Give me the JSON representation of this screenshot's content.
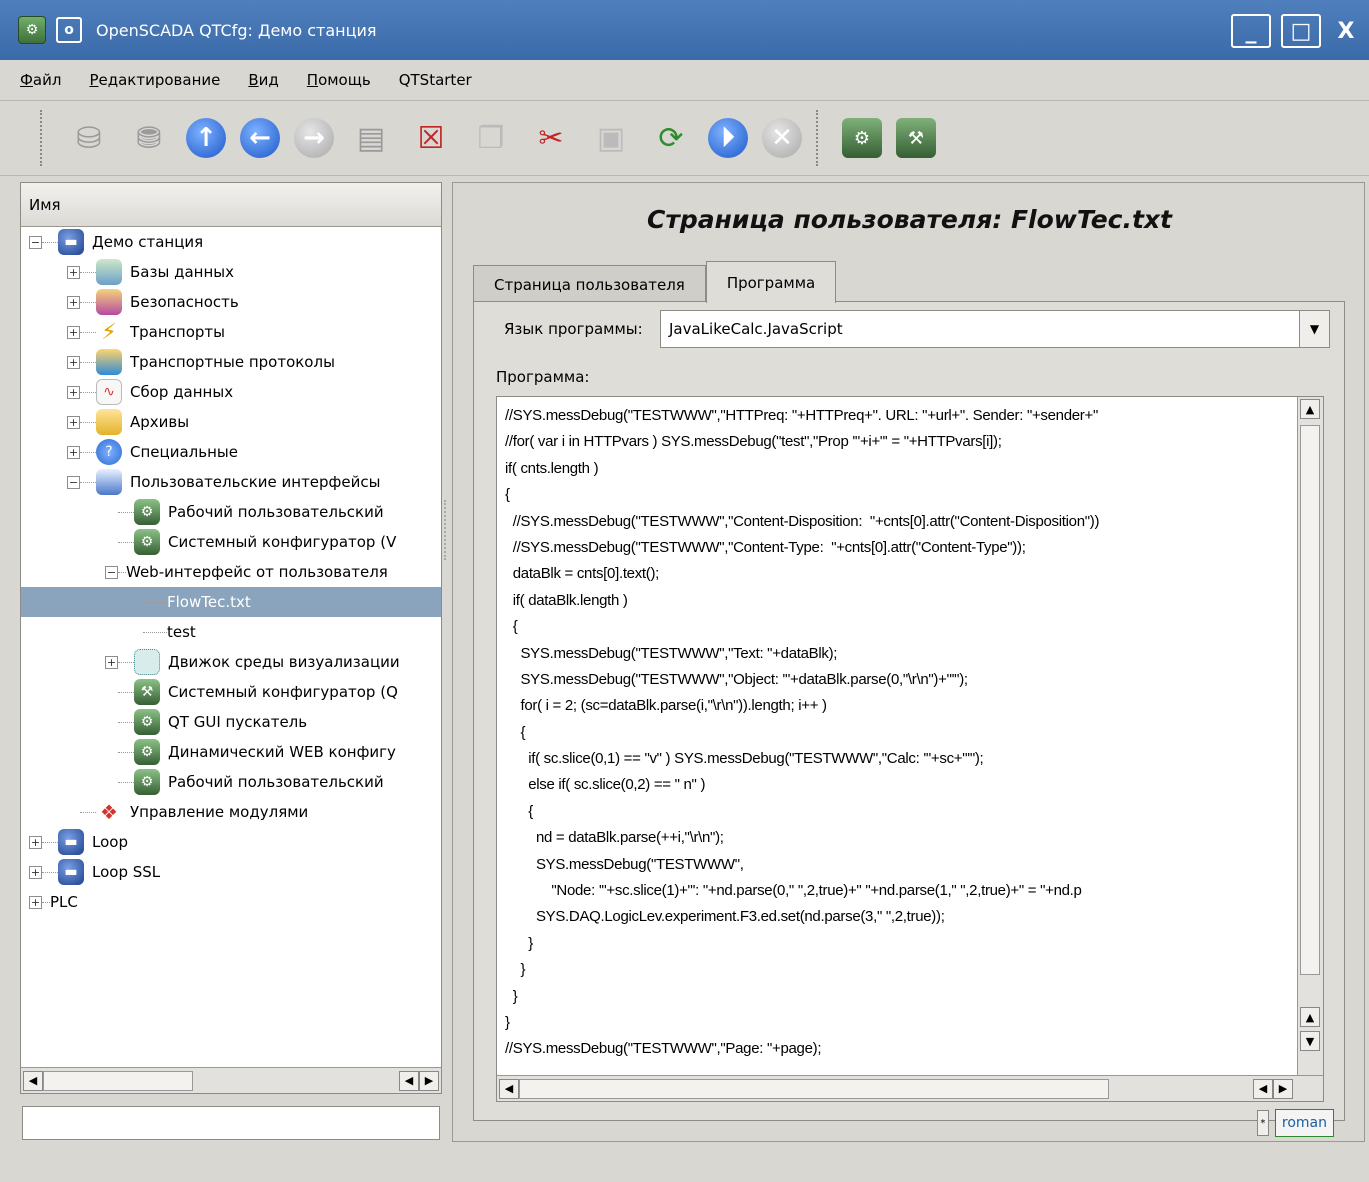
{
  "window": {
    "title": "OpenSCADA QTCfg: Демо станция",
    "menu_glyph": "o",
    "minimize": "_",
    "maximize": "□",
    "close": "X"
  },
  "menu": {
    "items": [
      {
        "u": "Ф",
        "rest": "айл"
      },
      {
        "u": "Р",
        "rest": "едактирование"
      },
      {
        "u": "В",
        "rest": "ид"
      },
      {
        "u": "П",
        "rest": "омощь"
      },
      {
        "u": "",
        "rest": "QTStarter"
      }
    ]
  },
  "toolbar": {
    "icons": [
      "db-load-icon",
      "db-save-icon",
      "up-icon",
      "back-icon",
      "forward-icon",
      "add-item-icon",
      "delete-item-icon",
      "copy-icon",
      "cut-icon",
      "paste-icon",
      "refresh-icon",
      "start-icon",
      "stop-icon",
      "qtstarter-app-icon",
      "qtcfg-app-icon"
    ]
  },
  "tree": {
    "header": "Имя",
    "items": [
      {
        "label": "Демо станция",
        "icon": "station-icon"
      },
      {
        "label": "Базы данных",
        "icon": "database-icon"
      },
      {
        "label": "Безопасность",
        "icon": "security-icon"
      },
      {
        "label": "Транспорты",
        "icon": "transport-icon"
      },
      {
        "label": "Транспортные протоколы",
        "icon": "protocol-icon"
      },
      {
        "label": "Сбор данных",
        "icon": "daq-icon"
      },
      {
        "label": "Архивы",
        "icon": "archive-icon"
      },
      {
        "label": "Специальные",
        "icon": "special-icon"
      },
      {
        "label": "Пользовательские интерфейсы",
        "icon": "ui-icon"
      },
      {
        "label": "Рабочий пользовательский",
        "icon": "vision-app-icon"
      },
      {
        "label": "Системный конфигуратор (V",
        "icon": "webcfg-app-icon"
      },
      {
        "label": "Web-интерфейс от пользователя",
        "icon": ""
      },
      {
        "label": "FlowTec.txt",
        "icon": ""
      },
      {
        "label": "test",
        "icon": ""
      },
      {
        "label": "Движок среды визуализации",
        "icon": "vcaengine-icon"
      },
      {
        "label": "Системный конфигуратор (Q",
        "icon": "qtcfg-icon"
      },
      {
        "label": "QT GUI пускатель",
        "icon": "qtstarter-icon"
      },
      {
        "label": "Динамический WEB конфигу",
        "icon": "webcfgd-icon"
      },
      {
        "label": "Рабочий пользовательский",
        "icon": "webvision-icon"
      },
      {
        "label": "Управление модулями",
        "icon": "modules-icon"
      },
      {
        "label": "Loop",
        "icon": "station-icon"
      },
      {
        "label": "Loop SSL",
        "icon": "station-icon"
      },
      {
        "label": "PLC",
        "icon": ""
      }
    ]
  },
  "page": {
    "title": "Страница пользователя: FlowTec.txt",
    "tabs": [
      {
        "label": "Страница пользователя"
      },
      {
        "label": "Программа"
      }
    ],
    "language_label": "Язык программы:",
    "language_value": "JavaLikeCalc.JavaScript",
    "program_label": "Программа:"
  },
  "code_lines": [
    "//SYS.messDebug(\"TESTWWW\",\"HTTPreq: \"+HTTPreq+\". URL: \"+url+\". Sender: \"+sender+\"",
    "//for( var i in HTTPvars ) SYS.messDebug(\"test\",\"Prop '\"+i+\"' = \"+HTTPvars[i]);",
    "if( cnts.length )",
    "{",
    "  //SYS.messDebug(\"TESTWWW\",\"Content-Disposition:  \"+cnts[0].attr(\"Content-Disposition\"))",
    "  //SYS.messDebug(\"TESTWWW\",\"Content-Type:  \"+cnts[0].attr(\"Content-Type\"));",
    "  dataBlk = cnts[0].text();",
    "  if( dataBlk.length )",
    "  {",
    "    SYS.messDebug(\"TESTWWW\",\"Text: \"+dataBlk);",
    "    SYS.messDebug(\"TESTWWW\",\"Object: '\"+dataBlk.parse(0,\"\\r\\n\")+\"'\");",
    "    for( i = 2; (sc=dataBlk.parse(i,\"\\r\\n\")).length; i++ )",
    "    {",
    "      if( sc.slice(0,1) == \"v\" ) SYS.messDebug(\"TESTWWW\",\"Calc: '\"+sc+\"'\");",
    "      else if( sc.slice(0,2) == \" n\" )",
    "      {",
    "        nd = dataBlk.parse(++i,\"\\r\\n\");",
    "        SYS.messDebug(\"TESTWWW\",",
    "            \"Node: '\"+sc.slice(1)+\"': \"+nd.parse(0,\" \",2,true)+\" \"+nd.parse(1,\" \",2,true)+\" = \"+nd.p",
    "        SYS.DAQ.LogicLev.experiment.F3.ed.set(nd.parse(3,\" \",2,true));",
    "      }",
    "    }",
    "  }",
    "}",
    "//SYS.messDebug(\"TESTWWW\",\"Page: \"+page);"
  ],
  "status": {
    "user": "roman",
    "grip": "*"
  },
  "scroll": {
    "up": "▲",
    "down": "▼",
    "left": "◀",
    "right": "▶"
  },
  "colors": {
    "titlebar": "#3f6fae",
    "selection": "#8aa4bd",
    "window_bg": "#d9d7d2"
  }
}
